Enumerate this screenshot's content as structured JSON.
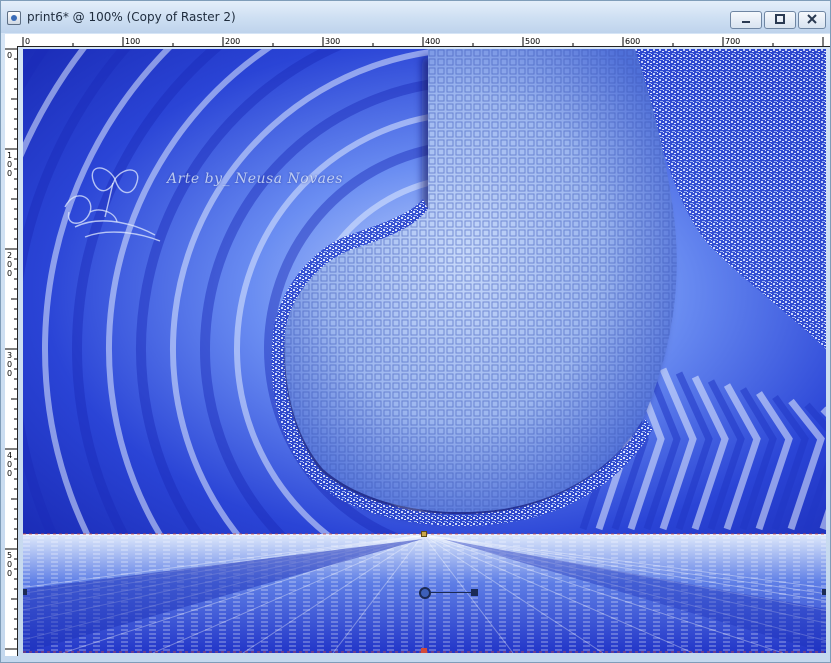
{
  "window": {
    "title": "print6* @ 100% (Copy of Raster 2)",
    "controls": {
      "minimize": "minimize-icon",
      "maximize": "maximize-icon",
      "close": "close-icon"
    }
  },
  "rulers": {
    "horizontal_labels": [
      "0",
      "100",
      "200",
      "300",
      "400",
      "500",
      "600",
      "700"
    ],
    "vertical_labels": [
      "0",
      "100",
      "200",
      "300",
      "400",
      "500"
    ]
  },
  "canvas": {
    "watermark": "Arte by_ Neusa Novaes",
    "colors": {
      "base_blue": "#2b3fd1",
      "light_blue": "#b9cff5",
      "deep_blue": "#1224a8"
    }
  }
}
